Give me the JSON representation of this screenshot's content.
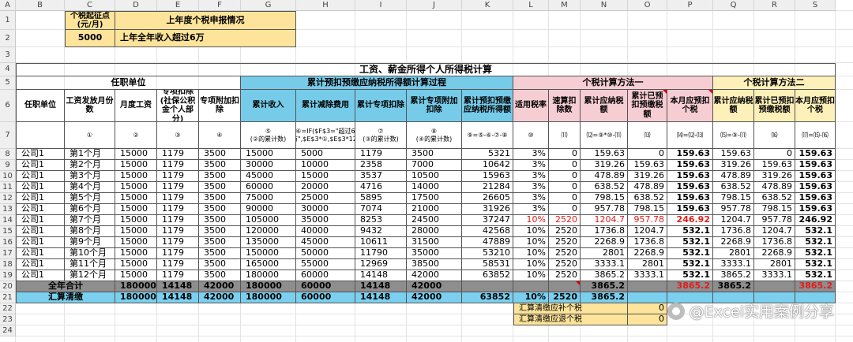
{
  "col_headers": [
    "A",
    "B",
    "C",
    "D",
    "E",
    "F",
    "G",
    "H",
    "I",
    "J",
    "K",
    "L",
    "M",
    "N",
    "O",
    "P",
    "Q",
    "R",
    "S"
  ],
  "row_numbers": [
    "1",
    "2",
    "3",
    "4",
    "5",
    "6",
    "7",
    "8",
    "9",
    "10",
    "11",
    "12",
    "13",
    "14",
    "15",
    "16",
    "17",
    "18",
    "19",
    "20",
    "21",
    "22",
    "23",
    "24",
    "25"
  ],
  "top_info": {
    "threshold_label": "个税起征点\n(元/月)",
    "threshold_value": "5000",
    "last_year_label": "上年度个税申报情况",
    "last_year_value": "上年全年收入超过6万"
  },
  "table_title": "工资、薪金所得个人所得税计算",
  "groups": {
    "employer": "任职单位",
    "cumulative": "累计预扣预缴应纳税所得额计算过程",
    "method1": "个税计算方法一",
    "method2": "个税计算方法二"
  },
  "headers": [
    "任职单位",
    "工资发放月份数",
    "月度工资",
    "专项扣除(社保公积金个人部分)",
    "专项附加扣除",
    "累计收入",
    "累计减除费用",
    "累计专项扣除",
    "累计专项附加扣除",
    "累计预扣预缴应纳税所得额",
    "适用税率",
    "速算扣除数",
    "累计应纳税额",
    "累计已预扣预缴税额",
    "本月应预扣个税",
    "累计应纳税额",
    "累计已预扣预缴税额",
    "本月应预扣个税"
  ],
  "formulas": [
    "",
    "①",
    "②",
    "③",
    "④",
    "⑤\n(②的累计数)",
    "⑥=IF($F$3=\"超过6万\",$E$3*①,$E$3*12)",
    "⑦\n(③的累计数)",
    "⑧\n(④的累计数)",
    "⑨=⑤-⑥-⑦-⑧",
    "⑩",
    "⑾",
    "⑿=⑨*⑩-⑾",
    "⒀",
    "⒁=⑿-⒀",
    "⒂=⑨-⑾",
    "⒃",
    "⒄=⒂-⒃"
  ],
  "rows": [
    [
      "公司1",
      "第1个月",
      "15000",
      "1179",
      "3500",
      "15000",
      "5000",
      "1179",
      "3500",
      "5321",
      "3%",
      "0",
      "159.63",
      "0",
      "159.63",
      "159.63",
      "0",
      "159.63"
    ],
    [
      "公司1",
      "第2个月",
      "15000",
      "1179",
      "3500",
      "30000",
      "10000",
      "2358",
      "7000",
      "10642",
      "3%",
      "0",
      "319.26",
      "159.63",
      "159.63",
      "319.26",
      "159.63",
      "159.63"
    ],
    [
      "公司1",
      "第3个月",
      "15000",
      "1179",
      "3500",
      "45000",
      "15000",
      "3537",
      "10500",
      "15963",
      "3%",
      "0",
      "478.89",
      "319.26",
      "159.63",
      "478.89",
      "319.26",
      "159.63"
    ],
    [
      "公司1",
      "第4个月",
      "15000",
      "1179",
      "3500",
      "60000",
      "20000",
      "4716",
      "14000",
      "21284",
      "3%",
      "0",
      "638.52",
      "478.89",
      "159.63",
      "638.52",
      "478.89",
      "159.63"
    ],
    [
      "公司1",
      "第5个月",
      "15000",
      "1179",
      "3500",
      "75000",
      "25000",
      "5895",
      "17500",
      "26605",
      "3%",
      "0",
      "798.15",
      "638.52",
      "159.63",
      "798.15",
      "638.52",
      "159.63"
    ],
    [
      "公司1",
      "第6个月",
      "15000",
      "1179",
      "3500",
      "90000",
      "30000",
      "7074",
      "21000",
      "31926",
      "3%",
      "0",
      "957.78",
      "798.15",
      "159.63",
      "957.78",
      "798.15",
      "159.63"
    ],
    [
      "公司1",
      "第7个月",
      "15000",
      "1179",
      "3500",
      "105000",
      "35000",
      "8253",
      "24500",
      "37247",
      "10%",
      "2520",
      "1204.7",
      "957.78",
      "246.92",
      "1204.7",
      "957.78",
      "246.92"
    ],
    [
      "公司1",
      "第8个月",
      "15000",
      "1179",
      "3500",
      "120000",
      "40000",
      "9432",
      "28000",
      "42568",
      "10%",
      "2520",
      "1736.8",
      "1204.7",
      "532.1",
      "1736.8",
      "1204.7",
      "532.1"
    ],
    [
      "公司1",
      "第9个月",
      "15000",
      "1179",
      "3500",
      "135000",
      "45000",
      "10611",
      "31500",
      "47889",
      "10%",
      "2520",
      "2268.9",
      "1736.8",
      "532.1",
      "2268.9",
      "1736.8",
      "532.1"
    ],
    [
      "公司1",
      "第10个月",
      "15000",
      "1179",
      "3500",
      "150000",
      "50000",
      "11790",
      "35000",
      "53210",
      "10%",
      "2520",
      "2801",
      "2268.9",
      "532.1",
      "2801",
      "2268.9",
      "532.1"
    ],
    [
      "公司1",
      "第11个月",
      "15000",
      "1179",
      "3500",
      "165000",
      "55000",
      "12969",
      "38500",
      "58531",
      "10%",
      "2520",
      "3333.1",
      "2801",
      "532.1",
      "3333.1",
      "2801",
      "532.1"
    ],
    [
      "公司1",
      "第12个月",
      "15000",
      "1179",
      "3500",
      "180000",
      "60000",
      "14148",
      "42000",
      "63852",
      "10%",
      "2520",
      "3865.2",
      "3333.1",
      "532.1",
      "3865.2",
      "3333.1",
      "532.1"
    ]
  ],
  "total_row": {
    "label": "全年合计",
    "d": "180000",
    "e": "14148",
    "f": "42000",
    "g": "180000",
    "h": "60000",
    "i": "14148",
    "j": "42000",
    "n": "3865.2",
    "p": "3865.2",
    "q": "3865.2",
    "s": "3865.2"
  },
  "settle_row": {
    "label": "汇算清缴",
    "d": "180000",
    "e": "14148",
    "f": "42000",
    "g": "180000",
    "h": "60000",
    "i": "14148",
    "j": "42000",
    "k": "63852",
    "l": "10%",
    "m": "2520",
    "n": "3865.2"
  },
  "footer": {
    "supp_label": "汇算清缴应补个税",
    "supp_value": "0",
    "refund_label": "汇算清缴应退个税",
    "refund_value": "0"
  },
  "watermark": "@Excel实用案例分享",
  "colors": {
    "yellow": "#fde49a",
    "blue": "#76cbe9",
    "pink": "#f7cdd4",
    "cream": "#fdf0b8",
    "gray": "#8e8e8e",
    "red": "#e31b1b"
  }
}
